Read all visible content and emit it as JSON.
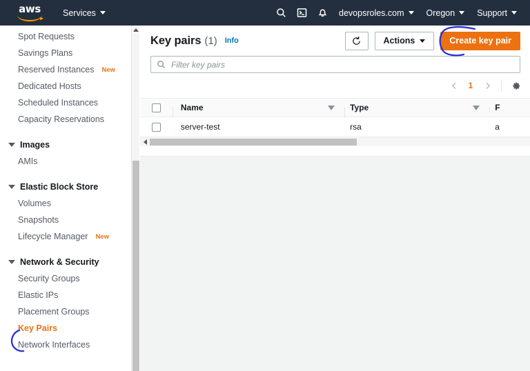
{
  "topnav": {
    "logo_text": "aws",
    "services_label": "Services",
    "search_icon": "search-icon",
    "cloudshell_icon": "cloudshell-icon",
    "bell_icon": "bell-icon",
    "account_label": "devopsroles.com",
    "region_label": "Oregon",
    "support_label": "Support"
  },
  "sidebar": {
    "items": [
      {
        "label": "Spot Requests",
        "type": "link",
        "badge": ""
      },
      {
        "label": "Savings Plans",
        "type": "link",
        "badge": ""
      },
      {
        "label": "Reserved Instances",
        "type": "link",
        "badge": "New"
      },
      {
        "label": "Dedicated Hosts",
        "type": "link",
        "badge": ""
      },
      {
        "label": "Scheduled Instances",
        "type": "link",
        "badge": ""
      },
      {
        "label": "Capacity Reservations",
        "type": "link",
        "badge": ""
      },
      {
        "label": "Images",
        "type": "group",
        "badge": ""
      },
      {
        "label": "AMIs",
        "type": "link",
        "badge": ""
      },
      {
        "label": "Elastic Block Store",
        "type": "group",
        "badge": ""
      },
      {
        "label": "Volumes",
        "type": "link",
        "badge": ""
      },
      {
        "label": "Snapshots",
        "type": "link",
        "badge": ""
      },
      {
        "label": "Lifecycle Manager",
        "type": "link",
        "badge": "New"
      },
      {
        "label": "Network & Security",
        "type": "group",
        "badge": ""
      },
      {
        "label": "Security Groups",
        "type": "link",
        "badge": ""
      },
      {
        "label": "Elastic IPs",
        "type": "link",
        "badge": ""
      },
      {
        "label": "Placement Groups",
        "type": "link",
        "badge": ""
      },
      {
        "label": "Key Pairs",
        "type": "link-active",
        "badge": ""
      },
      {
        "label": "Network Interfaces",
        "type": "link",
        "badge": ""
      }
    ]
  },
  "main": {
    "title": "Key pairs",
    "count": "(1)",
    "info_label": "Info",
    "refresh_icon": "refresh-icon",
    "actions_label": "Actions",
    "create_label": "Create key pair",
    "search": {
      "placeholder": "Filter key pairs",
      "value": "",
      "icon": "search-icon"
    },
    "pagination": {
      "prev_icon": "chevron-left-icon",
      "page": "1",
      "next_icon": "chevron-right-icon",
      "settings_icon": "gear-icon"
    },
    "table": {
      "columns": [
        "Name",
        "Type",
        "F"
      ],
      "rows": [
        {
          "name": "server-test",
          "type": "rsa",
          "fingerprint": "a"
        }
      ]
    }
  },
  "annotations": {
    "sidebar_mark": "blue-bracket-around-key-pairs",
    "button_mark": "blue-bracket-around-create-key-pair",
    "ink_color": "#2b30d6"
  },
  "colors": {
    "nav_bg": "#232f3e",
    "accent_orange": "#ec7211",
    "link_blue": "#0073bb",
    "panel_bg": "#f2f3f3"
  }
}
